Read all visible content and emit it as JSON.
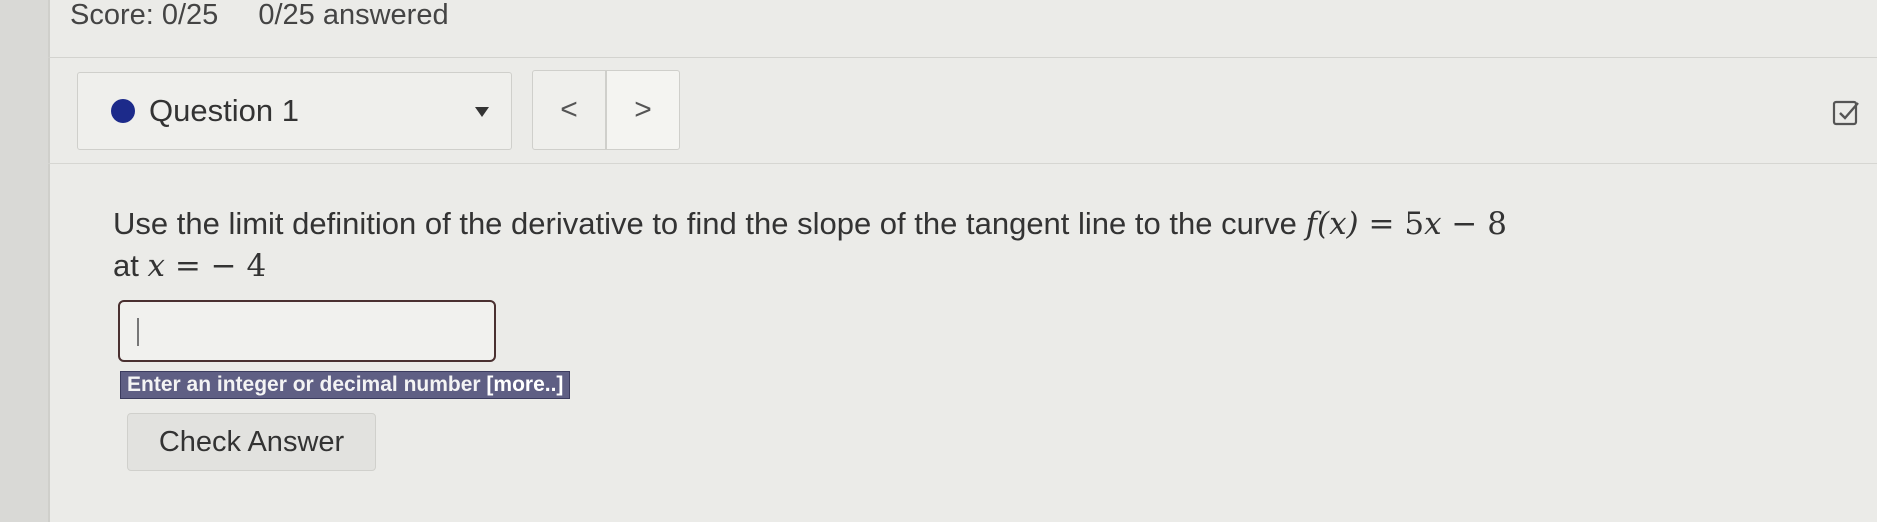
{
  "header": {
    "score": "Score: 0/25",
    "answered": "0/25 answered"
  },
  "question_nav": {
    "selected_question": "Question 1",
    "prev_symbol": "<",
    "next_symbol": ">",
    "status_color": "#1c2a8a"
  },
  "question": {
    "text_prefix": "Use the limit definition of the derivative to find the slope of the tangent line to the curve ",
    "function_lhs": "f(x)",
    "equals": "=",
    "function_rhs_coef": "5",
    "function_rhs_var": "x",
    "function_rhs_rest": " − 8",
    "line2_prefix": "at ",
    "point_var": "x",
    "point_value": " − 4"
  },
  "answer": {
    "value": "",
    "hint_text": "Enter an integer or decimal number ",
    "hint_more": "[more..]"
  },
  "actions": {
    "check_answer_label": "Check Answer"
  },
  "icons": {
    "checklist": "checklist-icon",
    "dropdown": "caret-down-icon"
  }
}
